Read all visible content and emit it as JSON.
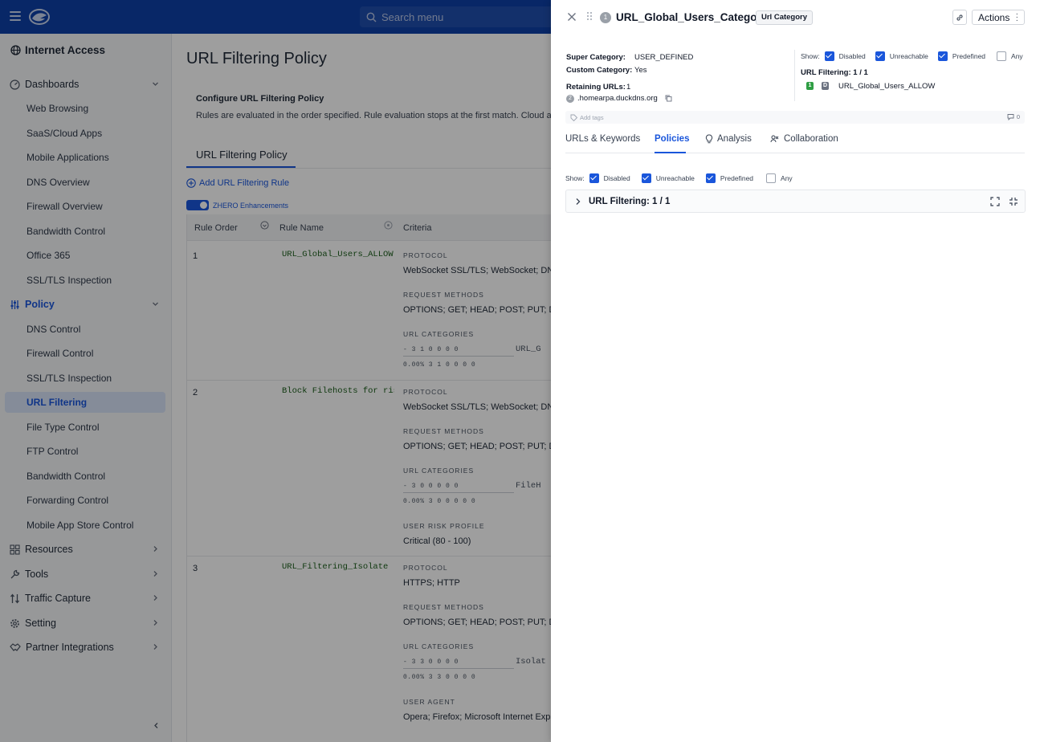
{
  "topbar": {
    "search_placeholder": "Search menu"
  },
  "sidebar": {
    "title": "Internet Access",
    "groups": {
      "dashboards": "Dashboards",
      "policy": "Policy",
      "resources": "Resources",
      "tools": "Tools",
      "traffic_capture": "Traffic Capture",
      "setting": "Setting",
      "partner_integrations": "Partner Integrations"
    },
    "dashboard_items": [
      "Web Browsing",
      "SaaS/Cloud Apps",
      "Mobile Applications",
      "DNS Overview",
      "Firewall Overview",
      "Bandwidth Control",
      "Office 365",
      "SSL/TLS Inspection"
    ],
    "policy_items": [
      "DNS Control",
      "Firewall Control",
      "SSL/TLS Inspection",
      "URL Filtering",
      "File Type Control",
      "FTP Control",
      "Bandwidth Control",
      "Forwarding Control",
      "Mobile App Store Control"
    ]
  },
  "main": {
    "page_title": "URL Filtering Policy",
    "config_title": "Configure URL Filtering Policy",
    "config_desc": "Rules are evaluated in the order specified. Rule evaluation stops at the first match. Cloud app c",
    "tab": "URL Filtering Policy",
    "add_rule": "Add URL Filtering Rule",
    "zhero": "ZHERO Enhancements",
    "columns": {
      "order": "Rule Order",
      "name": "Rule Name",
      "criteria": "Criteria"
    },
    "labels": {
      "protocol": "PROTOCOL",
      "request_methods": "REQUEST METHODS",
      "url_categories": "URL CATEGORIES",
      "user_risk_profile": "USER RISK PROFILE",
      "user_agent": "USER AGENT"
    },
    "rules": [
      {
        "order": "1",
        "name": "URL_Global_Users_ALLOW",
        "protocol": "WebSocket SSL/TLS; WebSocket; DNS",
        "methods": "OPTIONS; GET; HEAD; POST; PUT; DEL",
        "cat_row1": "-  3  1  0  0  0  0",
        "cat_row2": "0.00%  3  1  0  0  0  0",
        "cat_name": "URL_G"
      },
      {
        "order": "2",
        "name": "Block Filehosts for risky u",
        "protocol": "WebSocket SSL/TLS; WebSocket; DNS",
        "methods": "OPTIONS; GET; HEAD; POST; PUT; DEL",
        "cat_row1": "-  3  0  0  0  0  0",
        "cat_row2": "0.00%  3  0  0  0  0  0",
        "cat_name": "FileH",
        "risk": "Critical (80 - 100)"
      },
      {
        "order": "3",
        "name": "URL_Filtering_Isolate",
        "protocol": "HTTPS; HTTP",
        "methods": "OPTIONS; GET; HEAD; POST; PUT; DEL",
        "cat_row1": "-  3  3  0  0  0  0",
        "cat_row2": "0.00%  3  3  0  0  0  0",
        "cat_name": "Isolat",
        "agent": "Opera; Firefox; Microsoft Internet Explo"
      }
    ]
  },
  "drawer": {
    "index": "1",
    "title": "URL_Global_Users_Category",
    "badge": "Url Category",
    "actions": "Actions",
    "super_category_label": "Super Category:",
    "super_category_value": "USER_DEFINED",
    "custom_category_label": "Custom Category:",
    "custom_category_value": "Yes",
    "retaining_label": "Retaining URLs:",
    "retaining_value": "1",
    "url_index": "2",
    "url": ".homearpa.duckdns.org",
    "show_label": "Show:",
    "filters": {
      "disabled": "Disabled",
      "unreachable": "Unreachable",
      "predefined": "Predefined",
      "any": "Any"
    },
    "url_filtering_label": "URL Filtering: 1 / 1",
    "rule_num": "1",
    "rule_badge": "D",
    "rule_name": "URL_Global_Users_ALLOW",
    "add_tags": "Add tags",
    "comments_count": "0",
    "tabs": {
      "urls": "URLs & Keywords",
      "policies": "Policies",
      "analysis": "Analysis",
      "collaboration": "Collaboration"
    },
    "accordion_title": "URL Filtering: 1 / 1"
  },
  "colors": {
    "topbar": "#0d3fa6",
    "accent": "#1a56db",
    "rule_name": "#1a5d1a"
  }
}
